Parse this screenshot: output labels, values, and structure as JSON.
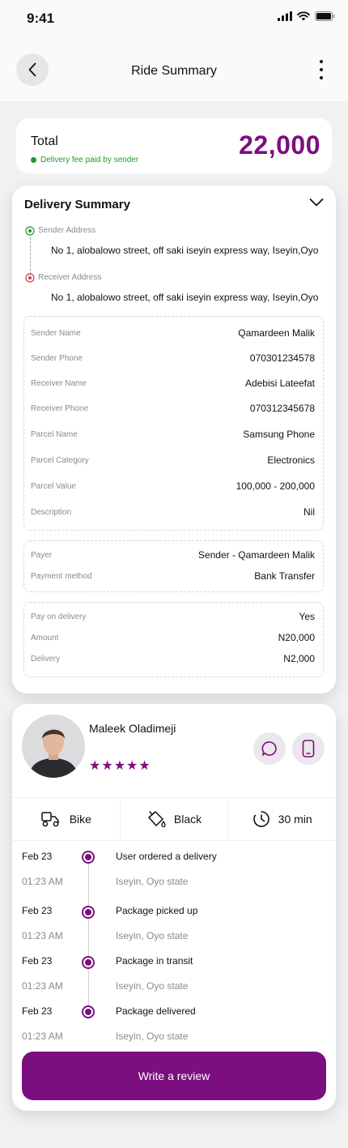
{
  "status": {
    "time": "9:41"
  },
  "header": {
    "title": "Ride Summary"
  },
  "total": {
    "label": "Total",
    "note": "Delivery fee paid by sender",
    "amount": "22,000"
  },
  "summary": {
    "title": "Delivery Summary",
    "sender_address_label": "Sender Address",
    "sender_address": "No 1, alobalowo street, off saki iseyin express way, Iseyin,Oyo",
    "receiver_address_label": "Receiver Address",
    "receiver_address": "No 1, alobalowo street, off saki iseyin express way, Iseyin,Oyo",
    "details": [
      {
        "k": "Sender Name",
        "v": "Qamardeen Malik"
      },
      {
        "k": "Sender Phone",
        "v": "070301234578"
      },
      {
        "k": "Receiver Name",
        "v": "Adebisi Lateefat"
      },
      {
        "k": "Receiver Phone",
        "v": "070312345678"
      },
      {
        "k": "Parcel Name",
        "v": "Samsung Phone"
      },
      {
        "k": "Parcel Category",
        "v": "Electronics"
      },
      {
        "k": "Parcel Value",
        "v": "100,000 - 200,000"
      },
      {
        "k": "Description",
        "v": "Nil"
      }
    ],
    "payment": [
      {
        "k": "Payer",
        "v": "Sender - Qamardeen Malik"
      },
      {
        "k": "Payment method",
        "v": "Bank Transfer"
      }
    ],
    "charges": [
      {
        "k": "Pay on delivery",
        "v": "Yes"
      },
      {
        "k": "Amount",
        "v": "N20,000"
      },
      {
        "k": "Delivery",
        "v": "N2,000"
      }
    ]
  },
  "rider": {
    "name": "Maleek Oladimeji",
    "rating": "★★★★★",
    "vehicle": "Bike",
    "color": "Black",
    "eta": "30 min"
  },
  "timeline": [
    {
      "date": "Feb 23",
      "time": "01:23 AM",
      "event": "User ordered a delivery",
      "location": "Iseyin, Oyo state"
    },
    {
      "date": "Feb 23",
      "time": "01:23 AM",
      "event": "Package picked up",
      "location": "Iseyin, Oyo state"
    },
    {
      "date": "Feb 23",
      "time": "01:23 AM",
      "event": "Package in transit",
      "location": "Iseyin, Oyo state"
    },
    {
      "date": "Feb 23",
      "time": "01:23 AM",
      "event": "Package delivered",
      "location": "Iseyin, Oyo state"
    }
  ],
  "review_button": "Write a review",
  "colors": {
    "accent": "#7b0f7f",
    "success": "#1f9a2f",
    "sender_marker": "#1f9a2f",
    "receiver_marker": "#d43a3a"
  }
}
